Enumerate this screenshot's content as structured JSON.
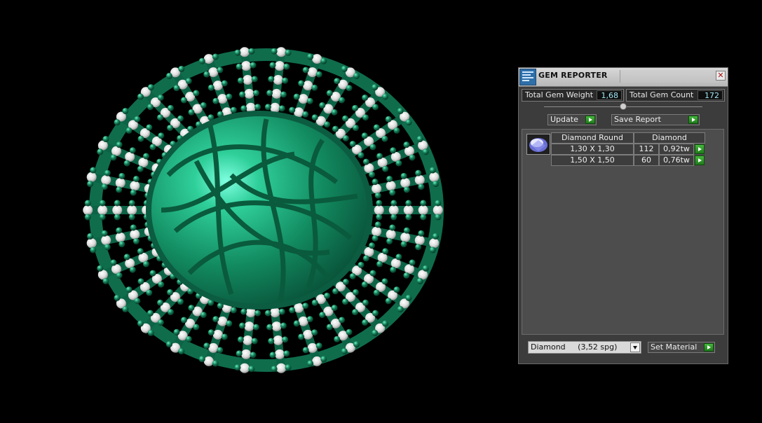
{
  "panel": {
    "title": "GEM REPORTER",
    "close_glyph": "✕",
    "stats": {
      "total_weight_label": "Total Gem Weight",
      "total_weight_value": "1,68",
      "total_count_label": "Total Gem Count",
      "total_count_value": "172"
    },
    "buttons": {
      "update": "Update",
      "save_report": "Save Report",
      "set_material": "Set Material"
    },
    "table": {
      "headers": [
        "Diamond Round",
        "Diamond"
      ],
      "rows": [
        {
          "size": "1,30 X 1,30",
          "count": "112",
          "weight": "0,92tw"
        },
        {
          "size": "1,50 X 1,50",
          "count": "60",
          "weight": "0,76tw"
        }
      ]
    },
    "material_select": {
      "value": "Diamond     (3,52 spg)"
    }
  },
  "icons": {
    "app": "gem-reporter-app-icon",
    "gem": "round-diamond-icon",
    "close": "close-icon",
    "go": "play-arrow-icon",
    "dropdown": "chevron-down-icon"
  },
  "colors": {
    "background": "#000000",
    "panel": "#3c3c3c",
    "value_text": "#9fe9f6",
    "accent_green": "#47b83d",
    "model_green": "#1f9e74"
  }
}
